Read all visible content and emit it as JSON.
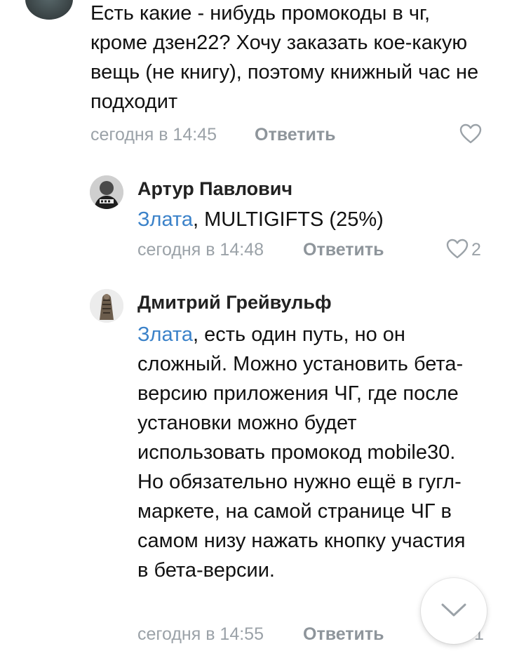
{
  "comments": [
    {
      "author": "",
      "mention": "",
      "text": "Есть какие - нибудь промокоды в чг, кроме дзен22? Хочу заказать кое-какую вещь (не книгу), поэтому книжный час не подходит",
      "timestamp": "сегодня в 14:45",
      "reply_label": "Ответить",
      "likes": ""
    },
    {
      "author": "Артур Павлович",
      "mention": "Злата",
      "text": ", MULTIGIFTS (25%)",
      "timestamp": "сегодня в 14:48",
      "reply_label": "Ответить",
      "likes": "2"
    },
    {
      "author": "Дмитрий Грейвульф",
      "mention": "Злата",
      "text": ", есть один путь, но он сложный. Можно установить бета-версию приложения ЧГ, где после установки можно будет использовать промокод mobile30. Но обязательно нужно ещё в гугл-маркете, на самой странице ЧГ в самом низу нажать кнопку участия в бета-версии.",
      "timestamp": "сегодня в 14:55",
      "reply_label": "Ответить",
      "likes": "1"
    }
  ],
  "scroll_button": {
    "icon": "chevron-down-icon"
  },
  "colors": {
    "mention": "#3b82c9",
    "meta": "#9ba2a8",
    "text": "#111111"
  }
}
